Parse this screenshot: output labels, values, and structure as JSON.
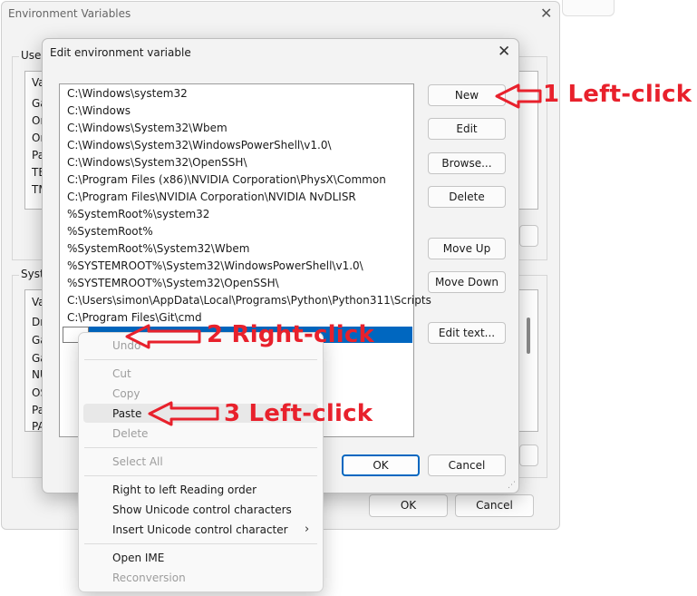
{
  "env_window": {
    "title": "Environment Variables",
    "user_group_label": "User",
    "user_col_header": "Va",
    "user_rows": [
      "Ga",
      "On",
      "On",
      "Pa",
      "TE",
      "TM"
    ],
    "system_group_label": "Syste",
    "system_col_header": "Va",
    "system_rows": [
      "Dr",
      "Ga",
      "Ga",
      "NU",
      "OS",
      "Pa",
      "PA"
    ],
    "ok_label": "OK",
    "cancel_label": "Cancel"
  },
  "edit_dialog": {
    "title": "Edit environment variable",
    "paths": [
      "C:\\Windows\\system32",
      "C:\\Windows",
      "C:\\Windows\\System32\\Wbem",
      "C:\\Windows\\System32\\WindowsPowerShell\\v1.0\\",
      "C:\\Windows\\System32\\OpenSSH\\",
      "C:\\Program Files (x86)\\NVIDIA Corporation\\PhysX\\Common",
      "C:\\Program Files\\NVIDIA Corporation\\NVIDIA NvDLISR",
      "%SystemRoot%\\system32",
      "%SystemRoot%",
      "%SystemRoot%\\System32\\Wbem",
      "%SYSTEMROOT%\\System32\\WindowsPowerShell\\v1.0\\",
      "%SYSTEMROOT%\\System32\\OpenSSH\\",
      "C:\\Users\\simon\\AppData\\Local\\Programs\\Python\\Python311\\Scripts",
      "C:\\Program Files\\Git\\cmd"
    ],
    "buttons": {
      "new": "New",
      "edit": "Edit",
      "browse": "Browse...",
      "delete": "Delete",
      "move_up": "Move Up",
      "move_down": "Move Down",
      "edit_text": "Edit text..."
    },
    "ok_label": "OK",
    "cancel_label": "Cancel"
  },
  "context_menu": {
    "items": [
      {
        "label": "Undo",
        "enabled": false
      },
      {
        "label": "Cut",
        "enabled": false
      },
      {
        "label": "Copy",
        "enabled": false
      },
      {
        "label": "Paste",
        "enabled": true
      },
      {
        "label": "Delete",
        "enabled": false
      },
      {
        "label": "Select All",
        "enabled": false
      },
      {
        "label": "Right to left Reading order",
        "enabled": true
      },
      {
        "label": "Show Unicode control characters",
        "enabled": true
      },
      {
        "label": "Insert Unicode control character",
        "enabled": true
      },
      {
        "label": "Open IME",
        "enabled": true
      },
      {
        "label": "Reconversion",
        "enabled": false
      }
    ]
  },
  "annotations": {
    "step1": "1 Left-click",
    "step2": "2 Right-click",
    "step3": "3 Left-click",
    "color": "#e8212c"
  },
  "colors": {
    "selection": "#0067c0",
    "dialog_bg": "#f3f3f3"
  }
}
